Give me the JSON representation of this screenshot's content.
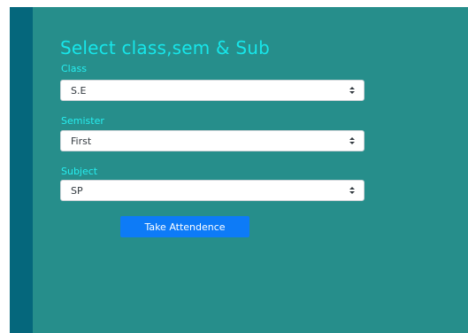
{
  "form": {
    "title": "Select class,sem & Sub",
    "class_label": "Class",
    "class_value": "S.E",
    "sem_label": "Semister",
    "sem_value": "First",
    "subject_label": "Subject",
    "subject_value": "SP",
    "submit_label": "Take Attendence"
  },
  "icons": {
    "select_caret": "updown-chevron-icon"
  },
  "colors": {
    "background": "#268e8b",
    "side_strip": "#05677c",
    "title": "#17e6ea",
    "label": "#26eef0",
    "button": "#0d7bf7"
  }
}
